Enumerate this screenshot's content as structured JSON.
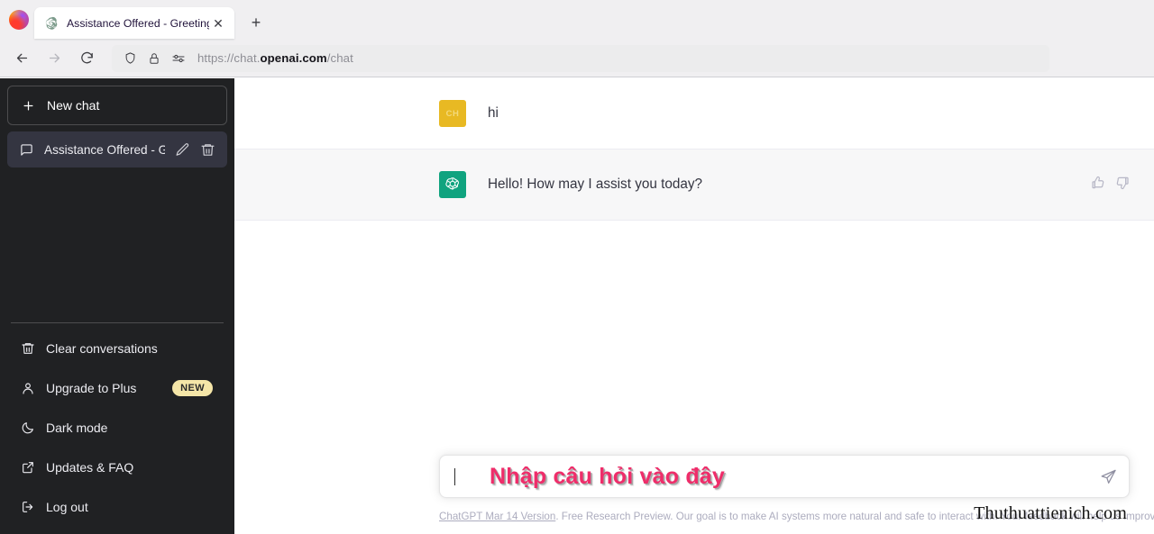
{
  "browser": {
    "tab": {
      "title": "Assistance Offered - Greeting.",
      "favicon_name": "chatgpt-favicon",
      "close_label": "✕"
    },
    "new_tab_label": "+",
    "nav": {
      "back_label": "back",
      "forward_label": "forward",
      "reload_label": "reload"
    },
    "url": {
      "prefix": "https://chat.",
      "domain": "openai.com",
      "path": "/chat",
      "full": "https://chat.openai.com/chat"
    }
  },
  "sidebar": {
    "new_chat_label": "New chat",
    "new_chat_icon": "plus-icon",
    "conversation": {
      "title": "Assistance Offered - Gr",
      "icon": "chat-bubble-icon",
      "edit_icon": "pencil-icon",
      "delete_icon": "trash-icon"
    },
    "menu": [
      {
        "label": "Clear conversations",
        "icon": "trash-icon",
        "badge": ""
      },
      {
        "label": "Upgrade to Plus",
        "icon": "person-icon",
        "badge": "NEW"
      },
      {
        "label": "Dark mode",
        "icon": "moon-icon",
        "badge": ""
      },
      {
        "label": "Updates & FAQ",
        "icon": "external-link-icon",
        "badge": ""
      },
      {
        "label": "Log out",
        "icon": "logout-icon",
        "badge": ""
      }
    ]
  },
  "conversation": {
    "messages": [
      {
        "role": "user",
        "avatar_initials": "CH",
        "text": "hi"
      },
      {
        "role": "assistant",
        "avatar_initials": "",
        "text": "Hello! How may I assist you today?"
      }
    ],
    "feedback": {
      "thumbs_up_icon": "thumbs-up-icon",
      "thumbs_down_icon": "thumbs-down-icon"
    }
  },
  "composer": {
    "value": "",
    "placeholder": "",
    "overlay_text": "Nhập câu hỏi vào đây",
    "send_icon": "send-paper-plane-icon"
  },
  "footer": {
    "link_text": "ChatGPT Mar 14 Version",
    "rest_text": ". Free Research Preview. Our goal is to make AI systems more natural and safe to interact with. Your feedback will help us improve."
  },
  "watermark": {
    "text": "Thuthuattienich.com"
  },
  "colors": {
    "sidebar_bg": "#202123",
    "conversation_active": "#343541",
    "brand_green": "#10a37f",
    "user_avatar": "#e8b923",
    "badge_new": "#f5e6a8",
    "overlay_pink": "#ef2d6a",
    "bot_msg_bg": "#f7f7f8"
  }
}
